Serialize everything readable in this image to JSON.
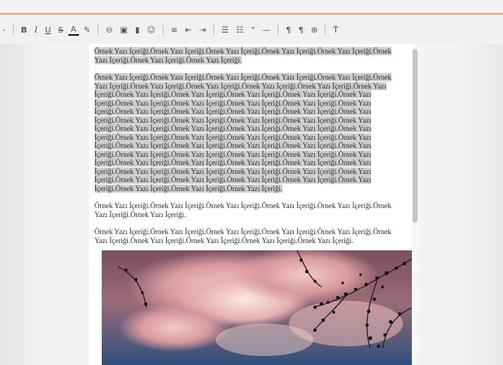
{
  "toolbar": {
    "items": [
      {
        "name": "dropdown-arrow-icon",
        "glyph": "-"
      },
      {
        "name": "bold-button",
        "glyph": "B"
      },
      {
        "name": "italic-button",
        "glyph": "I"
      },
      {
        "name": "underline-button",
        "glyph": "U"
      },
      {
        "name": "strikethrough-button",
        "glyph": "S"
      },
      {
        "name": "text-color-button",
        "glyph": "A"
      },
      {
        "name": "highlight-icon",
        "glyph": "✎"
      },
      {
        "name": "link-button",
        "glyph": "⊖"
      },
      {
        "name": "image-button",
        "glyph": "▣"
      },
      {
        "name": "video-button",
        "glyph": "▮"
      },
      {
        "name": "emoji-button",
        "glyph": "☺"
      },
      {
        "name": "align-button",
        "glyph": "≡"
      },
      {
        "name": "indent-decrease-button",
        "glyph": "⇤"
      },
      {
        "name": "indent-increase-button",
        "glyph": "⇥"
      },
      {
        "name": "bulleted-list-button",
        "glyph": "☰"
      },
      {
        "name": "numbered-list-button",
        "glyph": "☷"
      },
      {
        "name": "quote-button",
        "glyph": "”"
      },
      {
        "name": "horizontal-rule-button",
        "glyph": "—"
      },
      {
        "name": "ltr-button",
        "glyph": "¶"
      },
      {
        "name": "rtl-button",
        "glyph": "¶"
      },
      {
        "name": "language-button",
        "glyph": "⊕"
      },
      {
        "name": "clear-format-button",
        "glyph": "Ť"
      }
    ]
  },
  "content": {
    "para1": "Örnek Yazı İçeriği.Örnek Yazı İçeriği.Örnek Yazı İçeriği.Örnek Yazı İçeriği.Örnek Yazı İçeriği.Örnek Yazı İçeriği.Örnek Yazı İçeriği.Örnek Yazı İçeriği.",
    "para2": "Örnek Yazı İçeriği.Örnek Yazı İçeriği.Örnek Yazı İçeriği.Örnek Yazı İçeriği.Örnek Yazı İçeriği.Örnek Yazı İçeriği.Örnek Yazı İçeriği.Örnek Yazı İçeriği.Örnek Yazı İçeriği.Örnek Yazı İçeriği.Örnek Yazı İçeriği.Örnek Yazı İçeriği.Örnek Yazı İçeriği.Örnek Yazı İçeriği.Örnek Yazı İçeriği.Örnek Yazı İçeriği.Örnek Yazı İçeriği.Örnek Yazı İçeriği.Örnek Yazı İçeriği.Örnek Yazı İçeriği.Örnek Yazı İçeriği.Örnek Yazı İçeriği.Örnek Yazı İçeriği.Örnek Yazı İçeriği.Örnek Yazı İçeriği.Örnek Yazı İçeriği.Örnek Yazı İçeriği.Örnek Yazı İçeriği.Örnek Yazı İçeriği.Örnek Yazı İçeriği.Örnek Yazı İçeriği.Örnek Yazı İçeriği.Örnek Yazı İçeriği.Örnek Yazı İçeriği.Örnek Yazı İçeriği.Örnek Yazı İçeriği.Örnek Yazı İçeriği.Örnek Yazı İçeriği.Örnek Yazı İçeriği.Örnek Yazı İçeriği.Örnek Yazı İçeriği.Örnek Yazı İçeriği.Örnek Yazı İçeriği.Örnek Yazı İçeriği.Örnek Yazı İçeriği.Örnek Yazı İçeriği.Örnek Yazı İçeriği.Örnek Yazı İçeriği.Örnek Yazı İçeriği.Örnek Yazı İçeriği.Örnek Yazı İçeriği.Örnek Yazı İçeriği.Örnek Yazı İçeriği.Örnek Yazı İçeriği.Örnek Yazı İçeriği.Örnek Yazı İçeriği.Örnek Yazı İçeriği.Örnek Yazı İçeriği.Örnek Yazı İçeriği.Örnek Yazı İçeriği.Örnek Yazı İçeriği.Örnek Yazı İçeriği.Örnek Yazı İçeriği.Örnek Yazı İçeriği.Örnek Yazı İçeriği.Örnek Yazı İçeriği.Örnek Yazı İçeriği.Örnek Yazı İçeriği.Örnek Yazı İçeriği.",
    "para3": "Örnek Yazı İçeriği.Örnek Yazı İçeriği.Örnek Yazı İçeriği.Örnek Yazı İçeriği.Örnek Yazı İçeriği.Örnek Yazı İçeriği.Örnek Yazı İçeriği.",
    "para4": "Örnek Yazı İçeriği.Örnek Yazı İçeriği.Örnek Yazı İçeriği.Örnek Yazı İçeriği.Örnek Yazı İçeriği.Örnek Yazı İçeriği.Örnek Yazı İçeriği.Örnek Yazı İçeriği.Örnek Yazı İçeriği.Örnek Yazı İçeriği."
  },
  "colors": {
    "accent": "#f0a36d",
    "selection": "#cfcfcf"
  }
}
